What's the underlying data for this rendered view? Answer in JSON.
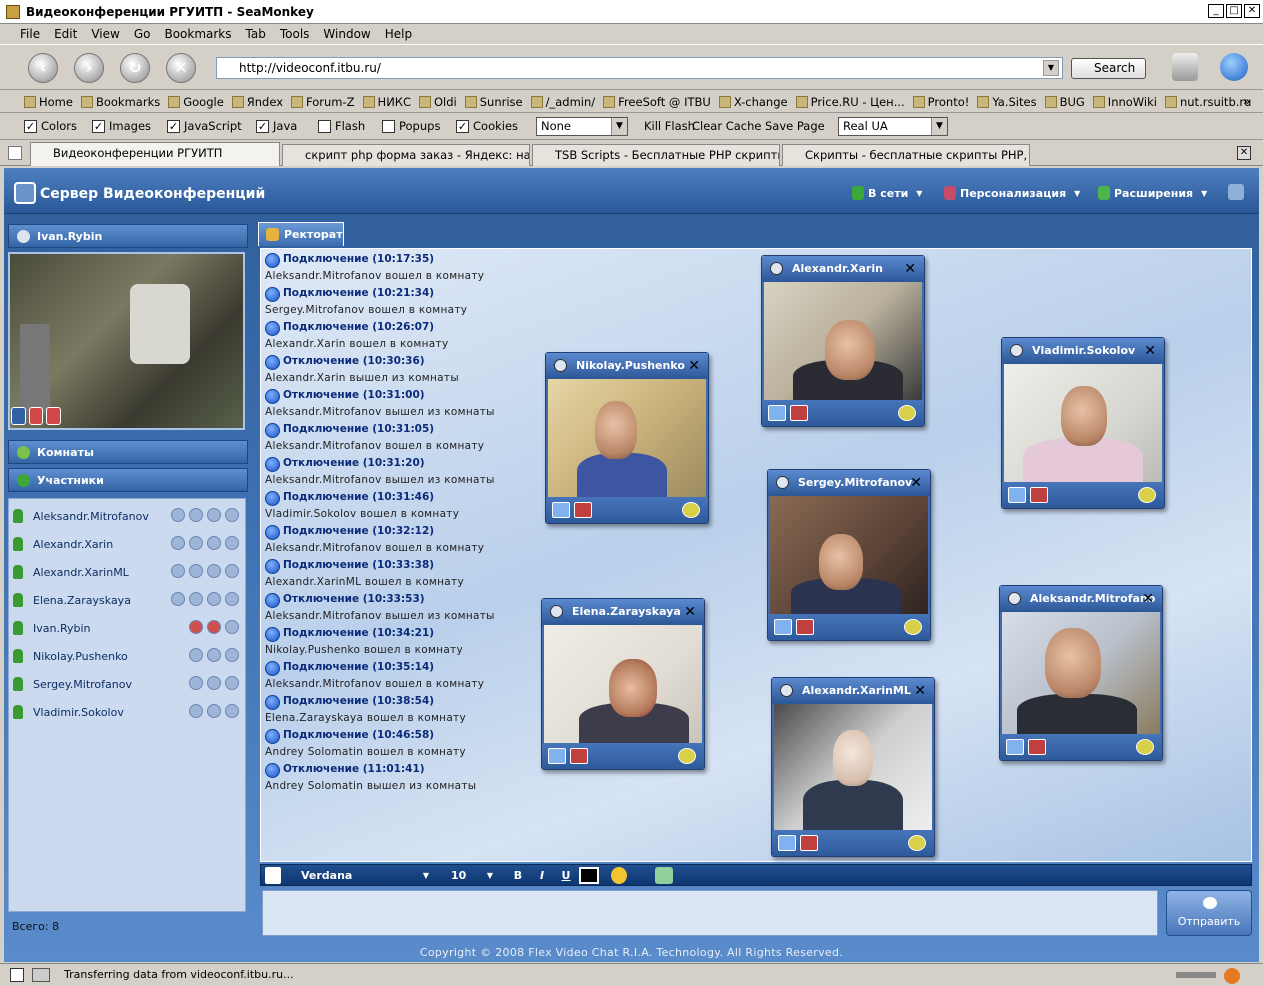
{
  "window": {
    "title": "Видеоконференции РГУИТП - SeaMonkey"
  },
  "menu": [
    "File",
    "Edit",
    "View",
    "Go",
    "Bookmarks",
    "Tab",
    "Tools",
    "Window",
    "Help"
  ],
  "nav": {
    "url": "http://videoconf.itbu.ru/",
    "search_label": "Search"
  },
  "bookmarks": [
    "Home",
    "Bookmarks",
    "Google",
    "Яndex",
    "Forum-Z",
    "НИКС",
    "Oldi",
    "Sunrise",
    "/_admin/",
    "FreeSoft @ ITBU",
    "X-change",
    "Price.RU - Цен...",
    "Pronto!",
    "Ya.Sites",
    "BUG",
    "InnoWiki",
    "nut.rsuitb.ru"
  ],
  "prefbar": {
    "checks": [
      {
        "label": "Colors",
        "checked": true
      },
      {
        "label": "Images",
        "checked": true
      },
      {
        "label": "JavaScript",
        "checked": true
      },
      {
        "label": "Java",
        "checked": true
      },
      {
        "label": "Flash",
        "checked": false
      },
      {
        "label": "Popups",
        "checked": false
      },
      {
        "label": "Cookies",
        "checked": true
      }
    ],
    "select1": "None",
    "kill_flash": "Kill Flash",
    "clear_cache": "Clear Cache",
    "save_page": "Save Page",
    "select2": "Real UA"
  },
  "tabs": [
    "Видеоконференции РГУИТП",
    "скрипт php форма заказ - Яндекс: нашл...",
    "TSB Scripts - Бесплатные PHP скрипты д...",
    "Скрипты - бесплатные скрипты PHP, Per..."
  ],
  "app": {
    "title": "Сервер Видеоконференций",
    "menu": [
      "В сети",
      "Персонализация",
      "Расширения"
    ],
    "self_user": "Ivan.Rybin",
    "rooms_label": "Комнаты",
    "participants_label": "Участники",
    "participants": [
      "Aleksandr.Mitrofanov",
      "Alexandr.Xarin",
      "Alexandr.XarinML",
      "Elena.Zarayskaya",
      "Ivan.Rybin",
      "Nikolay.Pushenko",
      "Sergey.Mitrofanov",
      "Vladimir.Sokolov"
    ],
    "total": "Всего: 8",
    "room_tab": "Ректорат",
    "log": [
      {
        "t": "ev",
        "text": "Подключение (10:17:35)"
      },
      {
        "t": "msg",
        "text": "Aleksandr.Mitrofanov вошел в комнату"
      },
      {
        "t": "ev",
        "text": "Подключение (10:21:34)"
      },
      {
        "t": "msg",
        "text": "Sergey.Mitrofanov вошел в комнату"
      },
      {
        "t": "ev",
        "text": "Подключение (10:26:07)"
      },
      {
        "t": "msg",
        "text": "Alexandr.Xarin вошел в комнату"
      },
      {
        "t": "ev",
        "text": "Отключение (10:30:36)"
      },
      {
        "t": "msg",
        "text": "Alexandr.Xarin вышел из комнаты"
      },
      {
        "t": "ev",
        "text": "Отключение (10:31:00)"
      },
      {
        "t": "msg",
        "text": "Aleksandr.Mitrofanov вышел из комнаты"
      },
      {
        "t": "ev",
        "text": "Подключение (10:31:05)"
      },
      {
        "t": "msg",
        "text": "Aleksandr.Mitrofanov вошел в комнату"
      },
      {
        "t": "ev",
        "text": "Отключение (10:31:20)"
      },
      {
        "t": "msg",
        "text": "Aleksandr.Mitrofanov вышел из комнаты"
      },
      {
        "t": "ev",
        "text": "Подключение (10:31:46)"
      },
      {
        "t": "msg",
        "text": "Vladimir.Sokolov вошел в комнату"
      },
      {
        "t": "ev",
        "text": "Подключение (10:32:12)"
      },
      {
        "t": "msg",
        "text": "Aleksandr.Mitrofanov вошел в комнату"
      },
      {
        "t": "ev",
        "text": "Подключение (10:33:38)"
      },
      {
        "t": "msg",
        "text": "Alexandr.XarinML вошел в комнату"
      },
      {
        "t": "ev",
        "text": "Отключение (10:33:53)"
      },
      {
        "t": "msg",
        "text": "Aleksandr.Mitrofanov вышел из комнаты"
      },
      {
        "t": "ev",
        "text": "Подключение (10:34:21)"
      },
      {
        "t": "msg",
        "text": "Nikolay.Pushenko вошел в комнату"
      },
      {
        "t": "ev",
        "text": "Подключение (10:35:14)"
      },
      {
        "t": "msg",
        "text": "Aleksandr.Mitrofanov вошел в комнату"
      },
      {
        "t": "ev",
        "text": "Подключение (10:38:54)"
      },
      {
        "t": "msg",
        "text": "Elena.Zarayskaya вошел в комнату"
      },
      {
        "t": "ev",
        "text": "Подключение (10:46:58)"
      },
      {
        "t": "msg",
        "text": "Andrey Solomatin вошел в комнату"
      },
      {
        "t": "ev",
        "text": "Отключение (11:01:41)"
      },
      {
        "t": "msg",
        "text": "Andrey Solomatin вышел из комнаты"
      }
    ],
    "videos": {
      "nikolay": "Nikolay.Pushenko",
      "xarin": "Alexandr.Xarin",
      "sokolov": "Vladimir.Sokolov",
      "sergey": "Sergey.Mitrofanov",
      "elena": "Elena.Zarayskaya",
      "xarinml": "Alexandr.XarinML",
      "aleksandr": "Aleksandr.Mitrofano"
    },
    "editor": {
      "font": "Verdana",
      "size": "10",
      "bold": "B",
      "italic": "I",
      "underline": "U"
    },
    "send_label": "Отправить",
    "copyright": "Copyright © 2008 Flex Video Chat R.I.A. Technology. All Rights Reserved."
  },
  "status": "Transferring data from videoconf.itbu.ru..."
}
